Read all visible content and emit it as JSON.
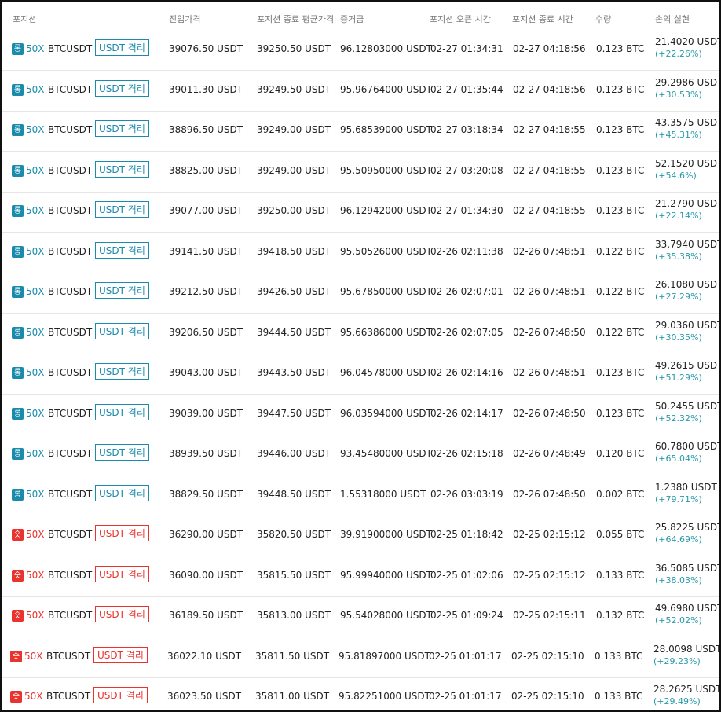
{
  "colors": {
    "long": "#1a8bab",
    "short": "#e8332e",
    "pnl_pct": "#2a9aa8"
  },
  "header": {
    "position": "포지션",
    "entry_price": "진입가격",
    "close_avg_price": "포지션 종료 평균가격",
    "margin": "증거금",
    "open_time": "포지션 오픈 시간",
    "close_time": "포지션 종료 시간",
    "quantity": "수량",
    "pnl": "손익 실현"
  },
  "rows": [
    {
      "side": "long",
      "side_label": "롱",
      "leverage": "50X",
      "symbol": "BTCUSDT",
      "margin_mode": "USDT 격리",
      "entry": "39076.50 USDT",
      "close_avg": "39250.50 USDT",
      "margin": "96.12803000 USDT",
      "open_time": "02-27 01:34:31",
      "close_time": "02-27 04:18:56",
      "qty": "0.123 BTC",
      "pnl": "21.4020 USDT",
      "pnl_pct": "(+22.26%)"
    },
    {
      "side": "long",
      "side_label": "롱",
      "leverage": "50X",
      "symbol": "BTCUSDT",
      "margin_mode": "USDT 격리",
      "entry": "39011.30 USDT",
      "close_avg": "39249.50 USDT",
      "margin": "95.96764000 USDT",
      "open_time": "02-27 01:35:44",
      "close_time": "02-27 04:18:56",
      "qty": "0.123 BTC",
      "pnl": "29.2986 USDT",
      "pnl_pct": "(+30.53%)"
    },
    {
      "side": "long",
      "side_label": "롱",
      "leverage": "50X",
      "symbol": "BTCUSDT",
      "margin_mode": "USDT 격리",
      "entry": "38896.50 USDT",
      "close_avg": "39249.00 USDT",
      "margin": "95.68539000 USDT",
      "open_time": "02-27 03:18:34",
      "close_time": "02-27 04:18:55",
      "qty": "0.123 BTC",
      "pnl": "43.3575 USDT",
      "pnl_pct": "(+45.31%)"
    },
    {
      "side": "long",
      "side_label": "롱",
      "leverage": "50X",
      "symbol": "BTCUSDT",
      "margin_mode": "USDT 격리",
      "entry": "38825.00 USDT",
      "close_avg": "39249.00 USDT",
      "margin": "95.50950000 USDT",
      "open_time": "02-27 03:20:08",
      "close_time": "02-27 04:18:55",
      "qty": "0.123 BTC",
      "pnl": "52.1520 USDT",
      "pnl_pct": "(+54.6%)"
    },
    {
      "side": "long",
      "side_label": "롱",
      "leverage": "50X",
      "symbol": "BTCUSDT",
      "margin_mode": "USDT 격리",
      "entry": "39077.00 USDT",
      "close_avg": "39250.00 USDT",
      "margin": "96.12942000 USDT",
      "open_time": "02-27 01:34:30",
      "close_time": "02-27 04:18:55",
      "qty": "0.123 BTC",
      "pnl": "21.2790 USDT",
      "pnl_pct": "(+22.14%)"
    },
    {
      "side": "long",
      "side_label": "롱",
      "leverage": "50X",
      "symbol": "BTCUSDT",
      "margin_mode": "USDT 격리",
      "entry": "39141.50 USDT",
      "close_avg": "39418.50 USDT",
      "margin": "95.50526000 USDT",
      "open_time": "02-26 02:11:38",
      "close_time": "02-26 07:48:51",
      "qty": "0.122 BTC",
      "pnl": "33.7940 USDT",
      "pnl_pct": "(+35.38%)"
    },
    {
      "side": "long",
      "side_label": "롱",
      "leverage": "50X",
      "symbol": "BTCUSDT",
      "margin_mode": "USDT 격리",
      "entry": "39212.50 USDT",
      "close_avg": "39426.50 USDT",
      "margin": "95.67850000 USDT",
      "open_time": "02-26 02:07:01",
      "close_time": "02-26 07:48:51",
      "qty": "0.122 BTC",
      "pnl": "26.1080 USDT",
      "pnl_pct": "(+27.29%)"
    },
    {
      "side": "long",
      "side_label": "롱",
      "leverage": "50X",
      "symbol": "BTCUSDT",
      "margin_mode": "USDT 격리",
      "entry": "39206.50 USDT",
      "close_avg": "39444.50 USDT",
      "margin": "95.66386000 USDT",
      "open_time": "02-26 02:07:05",
      "close_time": "02-26 07:48:50",
      "qty": "0.122 BTC",
      "pnl": "29.0360 USDT",
      "pnl_pct": "(+30.35%)"
    },
    {
      "side": "long",
      "side_label": "롱",
      "leverage": "50X",
      "symbol": "BTCUSDT",
      "margin_mode": "USDT 격리",
      "entry": "39043.00 USDT",
      "close_avg": "39443.50 USDT",
      "margin": "96.04578000 USDT",
      "open_time": "02-26 02:14:16",
      "close_time": "02-26 07:48:51",
      "qty": "0.123 BTC",
      "pnl": "49.2615 USDT",
      "pnl_pct": "(+51.29%)"
    },
    {
      "side": "long",
      "side_label": "롱",
      "leverage": "50X",
      "symbol": "BTCUSDT",
      "margin_mode": "USDT 격리",
      "entry": "39039.00 USDT",
      "close_avg": "39447.50 USDT",
      "margin": "96.03594000 USDT",
      "open_time": "02-26 02:14:17",
      "close_time": "02-26 07:48:50",
      "qty": "0.123 BTC",
      "pnl": "50.2455 USDT",
      "pnl_pct": "(+52.32%)"
    },
    {
      "side": "long",
      "side_label": "롱",
      "leverage": "50X",
      "symbol": "BTCUSDT",
      "margin_mode": "USDT 격리",
      "entry": "38939.50 USDT",
      "close_avg": "39446.00 USDT",
      "margin": "93.45480000 USDT",
      "open_time": "02-26 02:15:18",
      "close_time": "02-26 07:48:49",
      "qty": "0.120 BTC",
      "pnl": "60.7800 USDT",
      "pnl_pct": "(+65.04%)"
    },
    {
      "side": "long",
      "side_label": "롱",
      "leverage": "50X",
      "symbol": "BTCUSDT",
      "margin_mode": "USDT 격리",
      "entry": "38829.50 USDT",
      "close_avg": "39448.50 USDT",
      "margin": "1.55318000 USDT",
      "open_time": "02-26 03:03:19",
      "close_time": "02-26 07:48:50",
      "qty": "0.002 BTC",
      "pnl": "1.2380 USDT",
      "pnl_pct": "(+79.71%)"
    },
    {
      "side": "short",
      "side_label": "숏",
      "leverage": "50X",
      "symbol": "BTCUSDT",
      "margin_mode": "USDT 격리",
      "entry": "36290.00 USDT",
      "close_avg": "35820.50 USDT",
      "margin": "39.91900000 USDT",
      "open_time": "02-25 01:18:42",
      "close_time": "02-25 02:15:12",
      "qty": "0.055 BTC",
      "pnl": "25.8225 USDT",
      "pnl_pct": "(+64.69%)"
    },
    {
      "side": "short",
      "side_label": "숏",
      "leverage": "50X",
      "symbol": "BTCUSDT",
      "margin_mode": "USDT 격리",
      "entry": "36090.00 USDT",
      "close_avg": "35815.50 USDT",
      "margin": "95.99940000 USDT",
      "open_time": "02-25 01:02:06",
      "close_time": "02-25 02:15:12",
      "qty": "0.133 BTC",
      "pnl": "36.5085 USDT",
      "pnl_pct": "(+38.03%)"
    },
    {
      "side": "short",
      "side_label": "숏",
      "leverage": "50X",
      "symbol": "BTCUSDT",
      "margin_mode": "USDT 격리",
      "entry": "36189.50 USDT",
      "close_avg": "35813.00 USDT",
      "margin": "95.54028000 USDT",
      "open_time": "02-25 01:09:24",
      "close_time": "02-25 02:15:11",
      "qty": "0.132 BTC",
      "pnl": "49.6980 USDT",
      "pnl_pct": "(+52.02%)"
    },
    {
      "side": "short",
      "side_label": "숏",
      "leverage": "50X",
      "symbol": "BTCUSDT",
      "margin_mode": "USDT 격리",
      "entry": "36022.10 USDT",
      "close_avg": "35811.50 USDT",
      "margin": "95.81897000 USDT",
      "open_time": "02-25 01:01:17",
      "close_time": "02-25 02:15:10",
      "qty": "0.133 BTC",
      "pnl": "28.0098 USDT",
      "pnl_pct": "(+29.23%)"
    },
    {
      "side": "short",
      "side_label": "숏",
      "leverage": "50X",
      "symbol": "BTCUSDT",
      "margin_mode": "USDT 격리",
      "entry": "36023.50 USDT",
      "close_avg": "35811.00 USDT",
      "margin": "95.82251000 USDT",
      "open_time": "02-25 01:01:17",
      "close_time": "02-25 02:15:10",
      "qty": "0.133 BTC",
      "pnl": "28.2625 USDT",
      "pnl_pct": "(+29.49%)"
    }
  ]
}
